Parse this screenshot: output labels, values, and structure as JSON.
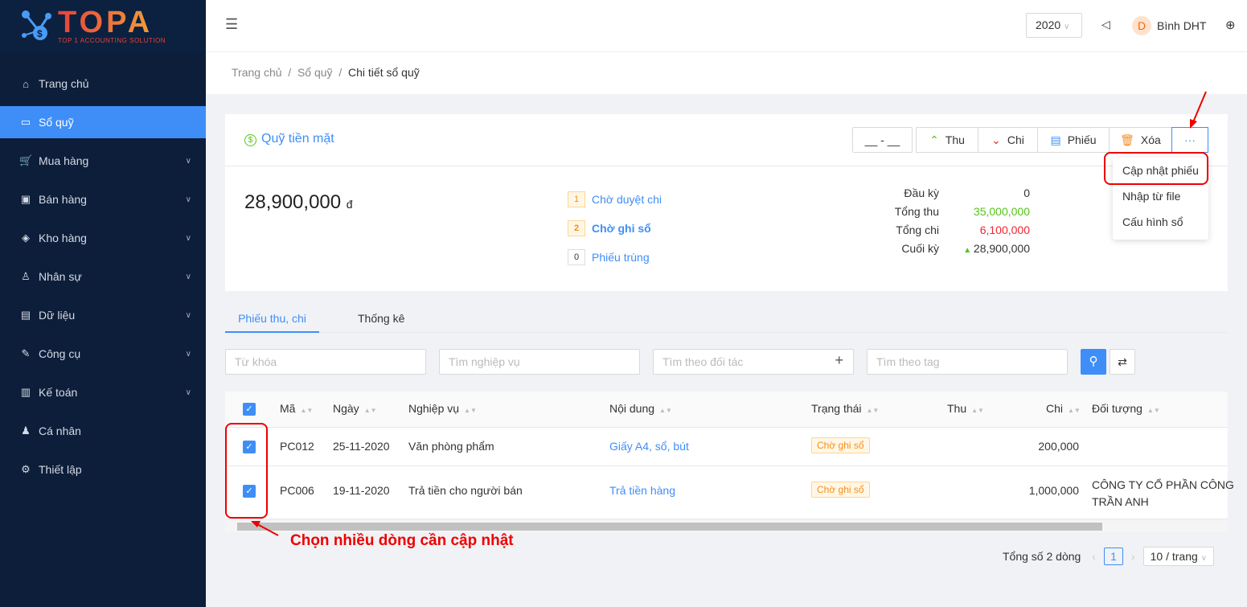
{
  "logo": {
    "text": "TOPA",
    "sub": "TOP 1 ACCOUNTING SOLUTION"
  },
  "sidebar": {
    "items": [
      {
        "label": "Trang chủ",
        "icon": "⌂"
      },
      {
        "label": "Sổ quỹ",
        "icon": "▭",
        "active": true
      },
      {
        "label": "Mua hàng",
        "icon": "🛒"
      },
      {
        "label": "Bán hàng",
        "icon": "▣"
      },
      {
        "label": "Kho hàng",
        "icon": "◈"
      },
      {
        "label": "Nhân sự",
        "icon": "♙"
      },
      {
        "label": "Dữ liệu",
        "icon": "▤"
      },
      {
        "label": "Công cụ",
        "icon": "✎"
      },
      {
        "label": "Kế toán",
        "icon": "▥"
      },
      {
        "label": "Cá nhân",
        "icon": "♟"
      },
      {
        "label": "Thiết lập",
        "icon": "⚙"
      }
    ]
  },
  "header": {
    "year": "2020",
    "user": "Bình DHT",
    "avatar": "D"
  },
  "breadcrumb": [
    "Trang chủ",
    "Sổ quỹ",
    "Chi tiết sổ quỹ"
  ],
  "card": {
    "title": "Quỹ tiền mặt",
    "balance": "28,900,000",
    "currency": "đ",
    "date_range": "__ - __",
    "buttons": {
      "thu": "Thu",
      "chi": "Chi",
      "phieu": "Phiếu",
      "xoa": "Xóa",
      "more": "···"
    },
    "statuses": [
      {
        "count": "1",
        "label": "Chờ duyệt chi"
      },
      {
        "count": "2",
        "label": "Chờ ghi sổ"
      },
      {
        "count": "0",
        "label": "Phiếu trùng"
      }
    ],
    "summary": [
      {
        "label": "Đầu kỳ",
        "value": "0"
      },
      {
        "label": "Tổng thu",
        "value": "35,000,000",
        "color": "#52c41a"
      },
      {
        "label": "Tổng chi",
        "value": "6,100,000",
        "color": "#f5222d"
      },
      {
        "label": "Cuối kỳ",
        "value": "28,900,000"
      }
    ]
  },
  "more_menu": [
    "Cập nhật phiếu",
    "Nhập từ file",
    "Cấu hình sổ"
  ],
  "tabs": [
    "Phiếu thu, chi",
    "Thống kê"
  ],
  "filters": {
    "keyword": "Từ khóa",
    "operation": "Tìm nghiệp vụ",
    "partner": "Tìm theo đối tác",
    "tag": "Tìm theo tag"
  },
  "table": {
    "columns": [
      "Mã",
      "Ngày",
      "Nghiệp vụ",
      "Nội dung",
      "Trạng thái",
      "Thu",
      "Chi",
      "Đối tượng"
    ],
    "rows": [
      {
        "code": "PC012",
        "date": "25-11-2020",
        "op": "Văn phòng phẩm",
        "content": "Giấy A4, sổ, bút",
        "status": "Chờ ghi sổ",
        "thu": "",
        "chi": "200,000",
        "obj1": "",
        "obj2": ""
      },
      {
        "code": "PC006",
        "date": "19-11-2020",
        "op": "Trả tiền cho người bán",
        "content": "Trả tiền hàng",
        "status": "Chờ ghi sổ",
        "thu": "",
        "chi": "1,000,000",
        "obj1": "CÔNG TY CỔ PHẦN CÔNG",
        "obj2": "TRẦN ANH"
      }
    ]
  },
  "pagination": {
    "total": "Tổng số 2 dòng",
    "page": "1",
    "size": "10 / trang"
  },
  "annotation": {
    "caption": "Chọn nhiều dòng cần cập nhật"
  },
  "colors": {
    "primary": "#3f8ef8",
    "sidebar": "#0c1e3a",
    "annotation": "#e00000"
  }
}
